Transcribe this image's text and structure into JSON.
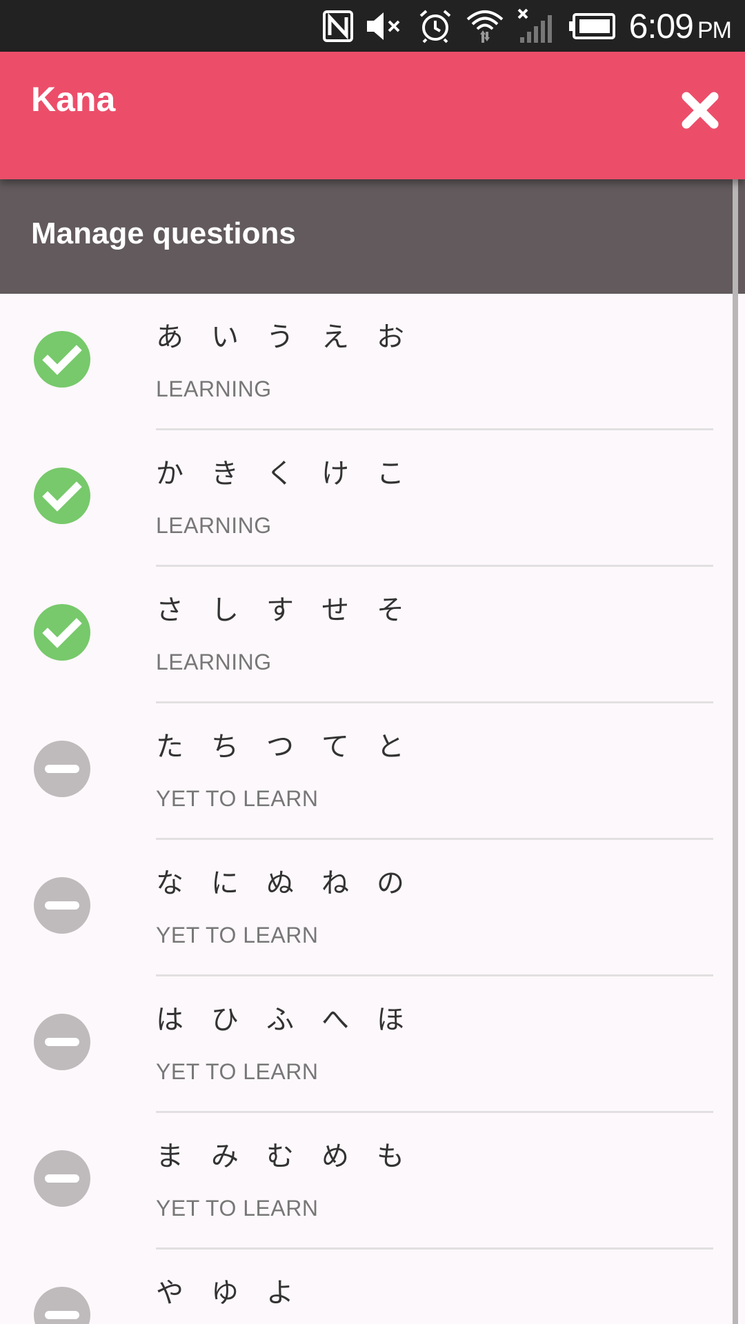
{
  "status_bar": {
    "time": "6:09",
    "ampm": "PM",
    "icons": [
      "nfc-icon",
      "volume-muted-icon",
      "alarm-icon",
      "wifi-icon",
      "signal-no-service-icon",
      "battery-icon"
    ]
  },
  "app_bar": {
    "title": "Kana",
    "close_icon": "close-icon",
    "background": "#ec4e6a"
  },
  "section": {
    "title": "Manage questions",
    "background": "#625a5c"
  },
  "colors": {
    "learning": "#77c96b",
    "yet_to_learn": "#bfbbbc"
  },
  "questions": [
    {
      "kana": [
        "あ",
        "い",
        "う",
        "え",
        "お"
      ],
      "status": "LEARNING",
      "icon": "check-circle-icon"
    },
    {
      "kana": [
        "か",
        "き",
        "く",
        "け",
        "こ"
      ],
      "status": "LEARNING",
      "icon": "check-circle-icon"
    },
    {
      "kana": [
        "さ",
        "し",
        "す",
        "せ",
        "そ"
      ],
      "status": "LEARNING",
      "icon": "check-circle-icon"
    },
    {
      "kana": [
        "た",
        "ち",
        "つ",
        "て",
        "と"
      ],
      "status": "YET TO LEARN",
      "icon": "minus-circle-icon"
    },
    {
      "kana": [
        "な",
        "に",
        "ぬ",
        "ね",
        "の"
      ],
      "status": "YET TO LEARN",
      "icon": "minus-circle-icon"
    },
    {
      "kana": [
        "は",
        "ひ",
        "ふ",
        "へ",
        "ほ"
      ],
      "status": "YET TO LEARN",
      "icon": "minus-circle-icon"
    },
    {
      "kana": [
        "ま",
        "み",
        "む",
        "め",
        "も"
      ],
      "status": "YET TO LEARN",
      "icon": "minus-circle-icon"
    },
    {
      "kana": [
        "や",
        "ゆ",
        "よ"
      ],
      "status": "",
      "icon": "minus-circle-icon"
    }
  ]
}
